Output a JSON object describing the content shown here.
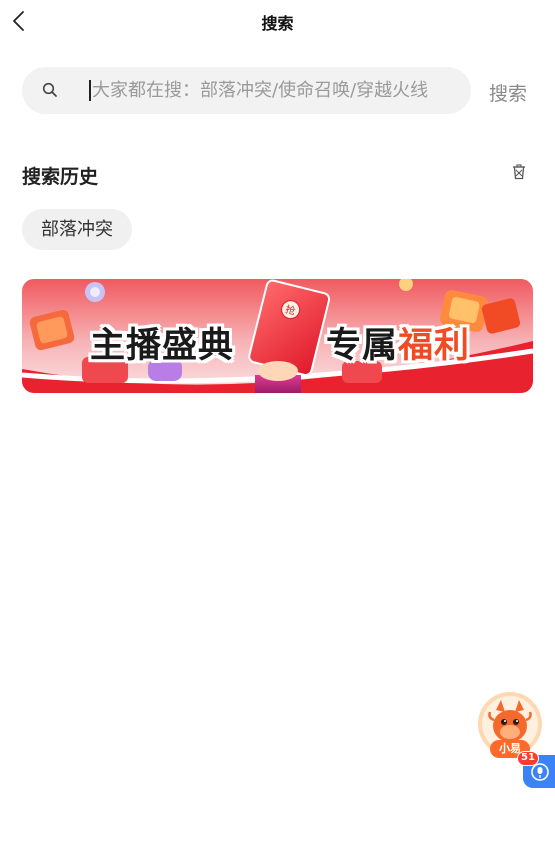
{
  "header": {
    "title": "搜索",
    "back_icon": "chevron-left-icon"
  },
  "search": {
    "placeholder": "大家都在搜：部落冲突/使命召唤/穿越火线",
    "value": "",
    "button_label": "搜索",
    "icon": "search-icon"
  },
  "history": {
    "title": "搜索历史",
    "clear_icon": "trash-icon",
    "items": [
      "部落冲突"
    ]
  },
  "banner": {
    "text_1": "主播盛典",
    "text_2_plain": "专属",
    "text_2_accent": "福利",
    "envelope_char": "抢",
    "accent_color": "#f04b24"
  },
  "assistant": {
    "label": "小易",
    "badge": "51",
    "mic_icon": "microphone-icon"
  }
}
